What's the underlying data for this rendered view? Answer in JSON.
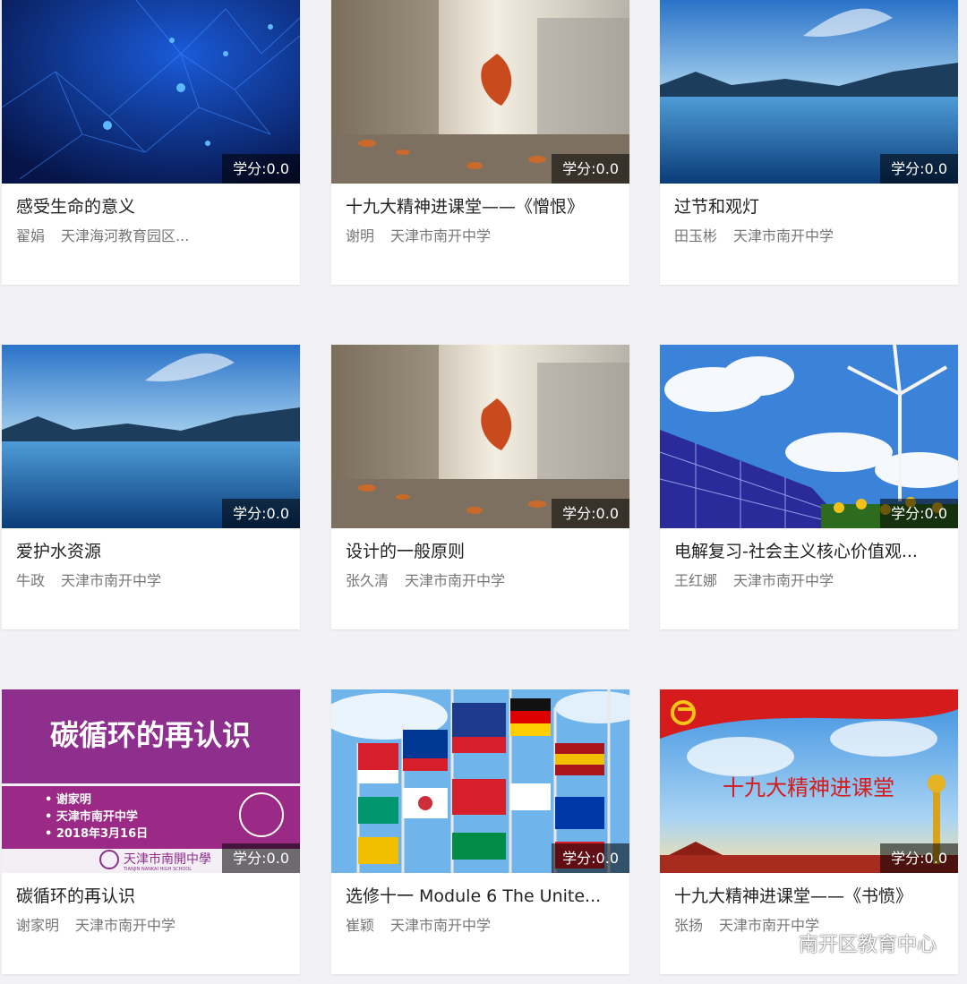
{
  "courses": [
    {
      "title": "感受生命的意义",
      "teacher": "翟娟",
      "school": "天津海河教育园区...",
      "credit": "学分:0.0"
    },
    {
      "title": "十九大精神进课堂——《憎恨》",
      "teacher": "谢明",
      "school": "天津市南开中学",
      "credit": "学分:0.0"
    },
    {
      "title": "过节和观灯",
      "teacher": "田玉彬",
      "school": "天津市南开中学",
      "credit": "学分:0.0"
    },
    {
      "title": "爱护水资源",
      "teacher": "牛政",
      "school": "天津市南开中学",
      "credit": "学分:0.0"
    },
    {
      "title": "设计的一般原则",
      "teacher": "张久清",
      "school": "天津市南开中学",
      "credit": "学分:0.0"
    },
    {
      "title": "电解复习-社会主义核心价值观...",
      "teacher": "王红娜",
      "school": "天津市南开中学",
      "credit": "学分:0.0"
    },
    {
      "title": "碳循环的再认识",
      "teacher": "谢家明",
      "school": "天津市南开中学",
      "credit": "学分:0.0"
    },
    {
      "title": "选修十一 Module 6 The Unite...",
      "teacher": "崔颖",
      "school": "天津市南开中学",
      "credit": "学分:0.0"
    },
    {
      "title": "十九大精神进课堂——《书愤》",
      "teacher": "张扬",
      "school": "天津市南开中学",
      "credit": "学分:0.0"
    }
  ],
  "thumb_text": {
    "carbon_title": "碳循环的再认识",
    "carbon_lines": [
      "• 谢家明",
      "• 天津市南开中学",
      "• 2018年3月16日"
    ],
    "carbon_school": "天津市南開中學",
    "carbon_school_en": "TIANJIN NANKAI HIGH SCHOOL",
    "party_title": "十九大精神进课堂"
  },
  "watermark": {
    "text": "南开区教育中心",
    "icon": "wechat-icon"
  }
}
